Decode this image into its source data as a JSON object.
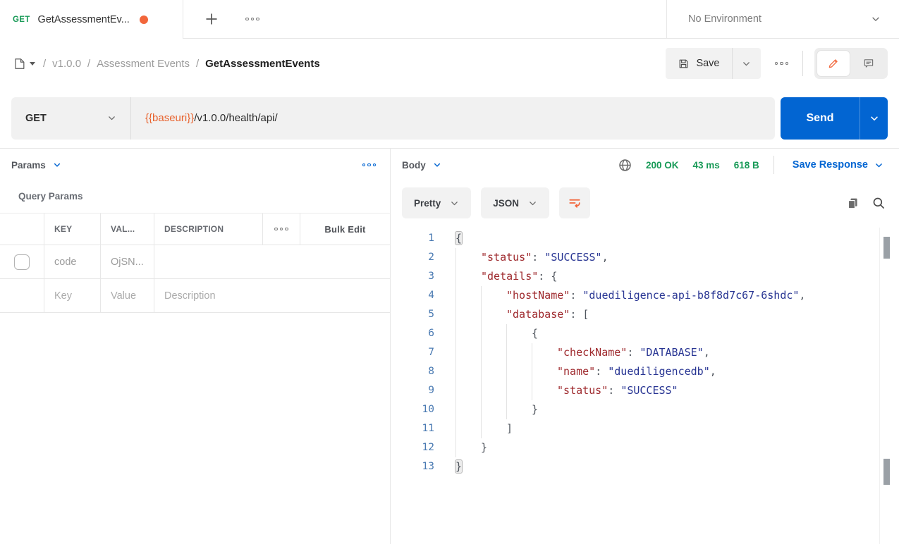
{
  "tab": {
    "method": "GET",
    "title": "GetAssessmentEv...",
    "environment": "No Environment"
  },
  "breadcrumb": {
    "separator": "/",
    "items": [
      "v1.0.0",
      "Assessment Events",
      "GetAssessmentEvents"
    ]
  },
  "header_actions": {
    "save_label": "Save"
  },
  "request": {
    "method": "GET",
    "url_variable": "{{baseuri}}",
    "url_path": "/v1.0.0/health/api/",
    "send_label": "Send"
  },
  "params": {
    "title": "Params",
    "section_title": "Query Params",
    "table": {
      "headers": {
        "key": "KEY",
        "value": "VAL...",
        "description": "DESCRIPTION",
        "bulk_edit": "Bulk Edit"
      },
      "rows": [
        {
          "key": "code",
          "value": "OjSN...",
          "description": ""
        }
      ],
      "placeholders": {
        "key": "Key",
        "value": "Value",
        "description": "Description"
      }
    }
  },
  "response": {
    "title": "Body",
    "status": "200 OK",
    "time": "43 ms",
    "size": "618 B",
    "save_label": "Save Response",
    "format": "Pretty",
    "language": "JSON",
    "lines": [
      {
        "n": 1,
        "i": 0,
        "t": [
          [
            "b",
            "{"
          ]
        ]
      },
      {
        "n": 2,
        "i": 1,
        "t": [
          [
            "k",
            "\"status\""
          ],
          [
            "p",
            ": "
          ],
          [
            "s",
            "\"SUCCESS\""
          ],
          [
            "p",
            ","
          ]
        ]
      },
      {
        "n": 3,
        "i": 1,
        "t": [
          [
            "k",
            "\"details\""
          ],
          [
            "p",
            ": {"
          ]
        ]
      },
      {
        "n": 4,
        "i": 2,
        "t": [
          [
            "k",
            "\"hostName\""
          ],
          [
            "p",
            ": "
          ],
          [
            "s",
            "\"duediligence-api-b8f8d7c67-6shdc\""
          ],
          [
            "p",
            ","
          ]
        ]
      },
      {
        "n": 5,
        "i": 2,
        "t": [
          [
            "k",
            "\"database\""
          ],
          [
            "p",
            ": ["
          ]
        ]
      },
      {
        "n": 6,
        "i": 3,
        "t": [
          [
            "p",
            "{"
          ]
        ]
      },
      {
        "n": 7,
        "i": 4,
        "t": [
          [
            "k",
            "\"checkName\""
          ],
          [
            "p",
            ": "
          ],
          [
            "s",
            "\"DATABASE\""
          ],
          [
            "p",
            ","
          ]
        ]
      },
      {
        "n": 8,
        "i": 4,
        "t": [
          [
            "k",
            "\"name\""
          ],
          [
            "p",
            ": "
          ],
          [
            "s",
            "\"duediligencedb\""
          ],
          [
            "p",
            ","
          ]
        ]
      },
      {
        "n": 9,
        "i": 4,
        "t": [
          [
            "k",
            "\"status\""
          ],
          [
            "p",
            ": "
          ],
          [
            "s",
            "\"SUCCESS\""
          ]
        ]
      },
      {
        "n": 10,
        "i": 3,
        "t": [
          [
            "p",
            "}"
          ]
        ]
      },
      {
        "n": 11,
        "i": 2,
        "t": [
          [
            "p",
            "]"
          ]
        ]
      },
      {
        "n": 12,
        "i": 1,
        "t": [
          [
            "p",
            "}"
          ]
        ]
      },
      {
        "n": 13,
        "i": 0,
        "t": [
          [
            "b",
            "}"
          ]
        ]
      }
    ]
  },
  "colors": {
    "accent_orange": "#f2663b",
    "primary_blue": "#0265d2",
    "success_green": "#189a57",
    "json_key": "#9e282c",
    "json_string": "#283593",
    "line_number": "#4a7ab2"
  }
}
